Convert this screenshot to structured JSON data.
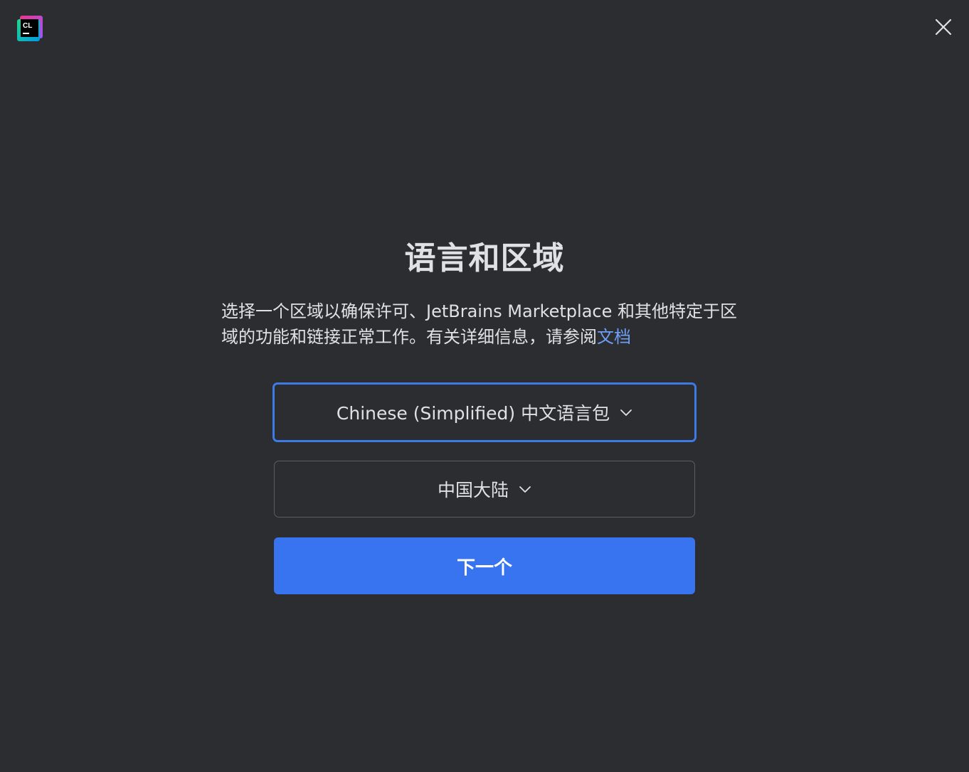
{
  "window": {
    "logo_text": "CL",
    "close_icon": "close-icon"
  },
  "main": {
    "title": "语言和区域",
    "description_text": "选择一个区域以确保许可、JetBrains Marketplace 和其他特定于区域的功能和链接正常工作。有关详细信息，请参阅",
    "description_link": "文档",
    "language_select": {
      "value": "Chinese (Simplified) 中文语言包"
    },
    "region_select": {
      "value": "中国大陆"
    },
    "next_button_label": "下一个"
  },
  "colors": {
    "background": "#2b2d30",
    "accent": "#3874f0",
    "focus_border": "#3d7ae6",
    "link": "#6e9ff5",
    "text": "#dfe1e5"
  }
}
